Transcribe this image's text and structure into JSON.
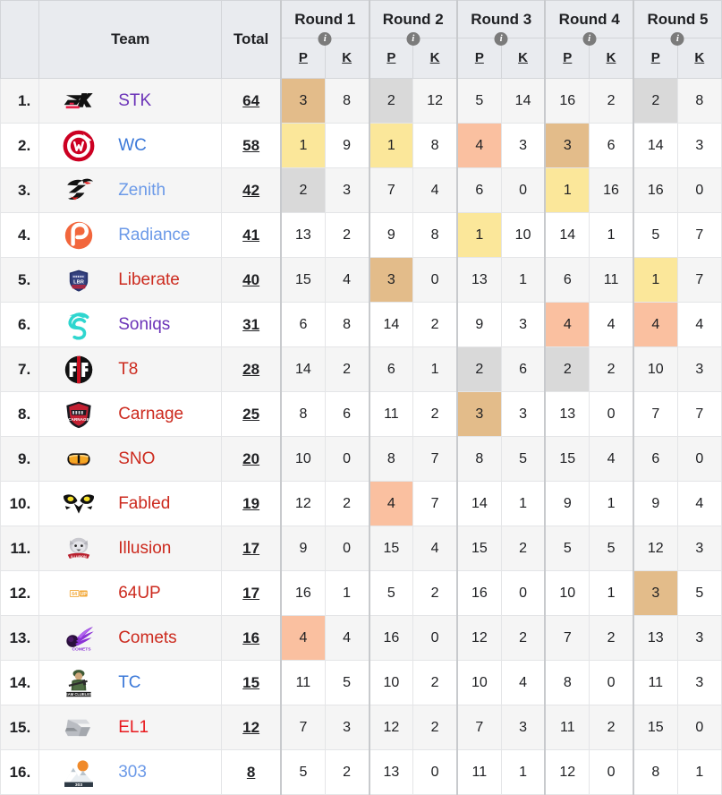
{
  "table": {
    "headers": {
      "rank": "",
      "team": "Team",
      "total": "Total",
      "rounds": [
        {
          "label": "Round 1",
          "info_icon": "info-icon",
          "p": "P",
          "k": "K"
        },
        {
          "label": "Round 2",
          "info_icon": "info-icon",
          "p": "P",
          "k": "K"
        },
        {
          "label": "Round 3",
          "info_icon": "info-icon",
          "p": "P",
          "k": "K"
        },
        {
          "label": "Round 4",
          "info_icon": "info-icon",
          "p": "P",
          "k": "K"
        },
        {
          "label": "Round 5",
          "info_icon": "info-icon",
          "p": "P",
          "k": "K"
        }
      ]
    },
    "highlight_colors": {
      "first": "#fbe79a",
      "second": "#d9d9d9",
      "third": "#e3bc8a",
      "fourth": "#fac0a0",
      "none": ""
    },
    "rows": [
      {
        "rank": "1.",
        "team": "STK",
        "team_color": "#6b33b8",
        "logo": "stk-logo",
        "total": "64",
        "cells": [
          {
            "v": "3",
            "hl": "third"
          },
          {
            "v": "8",
            "hl": "none"
          },
          {
            "v": "2",
            "hl": "second"
          },
          {
            "v": "12",
            "hl": "none"
          },
          {
            "v": "5",
            "hl": "none"
          },
          {
            "v": "14",
            "hl": "none"
          },
          {
            "v": "16",
            "hl": "none"
          },
          {
            "v": "2",
            "hl": "none"
          },
          {
            "v": "2",
            "hl": "second"
          },
          {
            "v": "8",
            "hl": "none"
          }
        ]
      },
      {
        "rank": "2.",
        "team": "WC",
        "team_color": "#3b78d8",
        "logo": "wc-logo",
        "total": "58",
        "cells": [
          {
            "v": "1",
            "hl": "first"
          },
          {
            "v": "9",
            "hl": "none"
          },
          {
            "v": "1",
            "hl": "first"
          },
          {
            "v": "8",
            "hl": "none"
          },
          {
            "v": "4",
            "hl": "fourth"
          },
          {
            "v": "3",
            "hl": "none"
          },
          {
            "v": "3",
            "hl": "third"
          },
          {
            "v": "6",
            "hl": "none"
          },
          {
            "v": "14",
            "hl": "none"
          },
          {
            "v": "3",
            "hl": "none"
          }
        ]
      },
      {
        "rank": "3.",
        "team": "Zenith",
        "team_color": "#6c9ae8",
        "logo": "zenith-logo",
        "total": "42",
        "cells": [
          {
            "v": "2",
            "hl": "second"
          },
          {
            "v": "3",
            "hl": "none"
          },
          {
            "v": "7",
            "hl": "none"
          },
          {
            "v": "4",
            "hl": "none"
          },
          {
            "v": "6",
            "hl": "none"
          },
          {
            "v": "0",
            "hl": "none"
          },
          {
            "v": "1",
            "hl": "first"
          },
          {
            "v": "16",
            "hl": "none"
          },
          {
            "v": "16",
            "hl": "none"
          },
          {
            "v": "0",
            "hl": "none"
          }
        ]
      },
      {
        "rank": "4.",
        "team": "Radiance",
        "team_color": "#6c9ae8",
        "logo": "radiance-logo",
        "total": "41",
        "cells": [
          {
            "v": "13",
            "hl": "none"
          },
          {
            "v": "2",
            "hl": "none"
          },
          {
            "v": "9",
            "hl": "none"
          },
          {
            "v": "8",
            "hl": "none"
          },
          {
            "v": "1",
            "hl": "first"
          },
          {
            "v": "10",
            "hl": "none"
          },
          {
            "v": "14",
            "hl": "none"
          },
          {
            "v": "1",
            "hl": "none"
          },
          {
            "v": "5",
            "hl": "none"
          },
          {
            "v": "7",
            "hl": "none"
          }
        ]
      },
      {
        "rank": "5.",
        "team": "Liberate",
        "team_color": "#cc2a1e",
        "logo": "liberate-logo",
        "total": "40",
        "cells": [
          {
            "v": "15",
            "hl": "none"
          },
          {
            "v": "4",
            "hl": "none"
          },
          {
            "v": "3",
            "hl": "third"
          },
          {
            "v": "0",
            "hl": "none"
          },
          {
            "v": "13",
            "hl": "none"
          },
          {
            "v": "1",
            "hl": "none"
          },
          {
            "v": "6",
            "hl": "none"
          },
          {
            "v": "11",
            "hl": "none"
          },
          {
            "v": "1",
            "hl": "first"
          },
          {
            "v": "7",
            "hl": "none"
          }
        ]
      },
      {
        "rank": "6.",
        "team": "Soniqs",
        "team_color": "#6b33b8",
        "logo": "soniqs-logo",
        "total": "31",
        "cells": [
          {
            "v": "6",
            "hl": "none"
          },
          {
            "v": "8",
            "hl": "none"
          },
          {
            "v": "14",
            "hl": "none"
          },
          {
            "v": "2",
            "hl": "none"
          },
          {
            "v": "9",
            "hl": "none"
          },
          {
            "v": "3",
            "hl": "none"
          },
          {
            "v": "4",
            "hl": "fourth"
          },
          {
            "v": "4",
            "hl": "none"
          },
          {
            "v": "4",
            "hl": "fourth"
          },
          {
            "v": "4",
            "hl": "none"
          }
        ]
      },
      {
        "rank": "7.",
        "team": "T8",
        "team_color": "#cc2a1e",
        "logo": "t8-logo",
        "total": "28",
        "cells": [
          {
            "v": "14",
            "hl": "none"
          },
          {
            "v": "2",
            "hl": "none"
          },
          {
            "v": "6",
            "hl": "none"
          },
          {
            "v": "1",
            "hl": "none"
          },
          {
            "v": "2",
            "hl": "second"
          },
          {
            "v": "6",
            "hl": "none"
          },
          {
            "v": "2",
            "hl": "second"
          },
          {
            "v": "2",
            "hl": "none"
          },
          {
            "v": "10",
            "hl": "none"
          },
          {
            "v": "3",
            "hl": "none"
          }
        ]
      },
      {
        "rank": "8.",
        "team": "Carnage",
        "team_color": "#cc2a1e",
        "logo": "carnage-logo",
        "total": "25",
        "cells": [
          {
            "v": "8",
            "hl": "none"
          },
          {
            "v": "6",
            "hl": "none"
          },
          {
            "v": "11",
            "hl": "none"
          },
          {
            "v": "2",
            "hl": "none"
          },
          {
            "v": "3",
            "hl": "third"
          },
          {
            "v": "3",
            "hl": "none"
          },
          {
            "v": "13",
            "hl": "none"
          },
          {
            "v": "0",
            "hl": "none"
          },
          {
            "v": "7",
            "hl": "none"
          },
          {
            "v": "7",
            "hl": "none"
          }
        ]
      },
      {
        "rank": "9.",
        "team": "SNO",
        "team_color": "#cc2a1e",
        "logo": "sno-logo",
        "total": "20",
        "cells": [
          {
            "v": "10",
            "hl": "none"
          },
          {
            "v": "0",
            "hl": "none"
          },
          {
            "v": "8",
            "hl": "none"
          },
          {
            "v": "7",
            "hl": "none"
          },
          {
            "v": "8",
            "hl": "none"
          },
          {
            "v": "5",
            "hl": "none"
          },
          {
            "v": "15",
            "hl": "none"
          },
          {
            "v": "4",
            "hl": "none"
          },
          {
            "v": "6",
            "hl": "none"
          },
          {
            "v": "0",
            "hl": "none"
          }
        ]
      },
      {
        "rank": "10.",
        "team": "Fabled",
        "team_color": "#cc2a1e",
        "logo": "fabled-logo",
        "total": "19",
        "cells": [
          {
            "v": "12",
            "hl": "none"
          },
          {
            "v": "2",
            "hl": "none"
          },
          {
            "v": "4",
            "hl": "fourth"
          },
          {
            "v": "7",
            "hl": "none"
          },
          {
            "v": "14",
            "hl": "none"
          },
          {
            "v": "1",
            "hl": "none"
          },
          {
            "v": "9",
            "hl": "none"
          },
          {
            "v": "1",
            "hl": "none"
          },
          {
            "v": "9",
            "hl": "none"
          },
          {
            "v": "4",
            "hl": "none"
          }
        ]
      },
      {
        "rank": "11.",
        "team": "Illusion",
        "team_color": "#cc2a1e",
        "logo": "illusion-logo",
        "total": "17",
        "cells": [
          {
            "v": "9",
            "hl": "none"
          },
          {
            "v": "0",
            "hl": "none"
          },
          {
            "v": "15",
            "hl": "none"
          },
          {
            "v": "4",
            "hl": "none"
          },
          {
            "v": "15",
            "hl": "none"
          },
          {
            "v": "2",
            "hl": "none"
          },
          {
            "v": "5",
            "hl": "none"
          },
          {
            "v": "5",
            "hl": "none"
          },
          {
            "v": "12",
            "hl": "none"
          },
          {
            "v": "3",
            "hl": "none"
          }
        ]
      },
      {
        "rank": "12.",
        "team": "64UP",
        "team_color": "#cc2a1e",
        "logo": "64up-logo",
        "total": "17",
        "cells": [
          {
            "v": "16",
            "hl": "none"
          },
          {
            "v": "1",
            "hl": "none"
          },
          {
            "v": "5",
            "hl": "none"
          },
          {
            "v": "2",
            "hl": "none"
          },
          {
            "v": "16",
            "hl": "none"
          },
          {
            "v": "0",
            "hl": "none"
          },
          {
            "v": "10",
            "hl": "none"
          },
          {
            "v": "1",
            "hl": "none"
          },
          {
            "v": "3",
            "hl": "third"
          },
          {
            "v": "5",
            "hl": "none"
          }
        ]
      },
      {
        "rank": "13.",
        "team": "Comets",
        "team_color": "#cc2a1e",
        "logo": "comets-logo",
        "total": "16",
        "cells": [
          {
            "v": "4",
            "hl": "fourth"
          },
          {
            "v": "4",
            "hl": "none"
          },
          {
            "v": "16",
            "hl": "none"
          },
          {
            "v": "0",
            "hl": "none"
          },
          {
            "v": "12",
            "hl": "none"
          },
          {
            "v": "2",
            "hl": "none"
          },
          {
            "v": "7",
            "hl": "none"
          },
          {
            "v": "2",
            "hl": "none"
          },
          {
            "v": "13",
            "hl": "none"
          },
          {
            "v": "3",
            "hl": "none"
          }
        ]
      },
      {
        "rank": "14.",
        "team": "TC",
        "team_color": "#3b78d8",
        "logo": "tc-logo",
        "total": "15",
        "cells": [
          {
            "v": "11",
            "hl": "none"
          },
          {
            "v": "5",
            "hl": "none"
          },
          {
            "v": "10",
            "hl": "none"
          },
          {
            "v": "2",
            "hl": "none"
          },
          {
            "v": "10",
            "hl": "none"
          },
          {
            "v": "4",
            "hl": "none"
          },
          {
            "v": "8",
            "hl": "none"
          },
          {
            "v": "0",
            "hl": "none"
          },
          {
            "v": "11",
            "hl": "none"
          },
          {
            "v": "3",
            "hl": "none"
          }
        ]
      },
      {
        "rank": "15.",
        "team": "EL1",
        "team_color": "#e8191e",
        "logo": "el1-logo",
        "total": "12",
        "cells": [
          {
            "v": "7",
            "hl": "none"
          },
          {
            "v": "3",
            "hl": "none"
          },
          {
            "v": "12",
            "hl": "none"
          },
          {
            "v": "2",
            "hl": "none"
          },
          {
            "v": "7",
            "hl": "none"
          },
          {
            "v": "3",
            "hl": "none"
          },
          {
            "v": "11",
            "hl": "none"
          },
          {
            "v": "2",
            "hl": "none"
          },
          {
            "v": "15",
            "hl": "none"
          },
          {
            "v": "0",
            "hl": "none"
          }
        ]
      },
      {
        "rank": "16.",
        "team": "303",
        "team_color": "#6c9ae8",
        "logo": "303-logo",
        "total": "8",
        "cells": [
          {
            "v": "5",
            "hl": "none"
          },
          {
            "v": "2",
            "hl": "none"
          },
          {
            "v": "13",
            "hl": "none"
          },
          {
            "v": "0",
            "hl": "none"
          },
          {
            "v": "11",
            "hl": "none"
          },
          {
            "v": "1",
            "hl": "none"
          },
          {
            "v": "12",
            "hl": "none"
          },
          {
            "v": "0",
            "hl": "none"
          },
          {
            "v": "8",
            "hl": "none"
          },
          {
            "v": "1",
            "hl": "none"
          }
        ]
      }
    ]
  }
}
